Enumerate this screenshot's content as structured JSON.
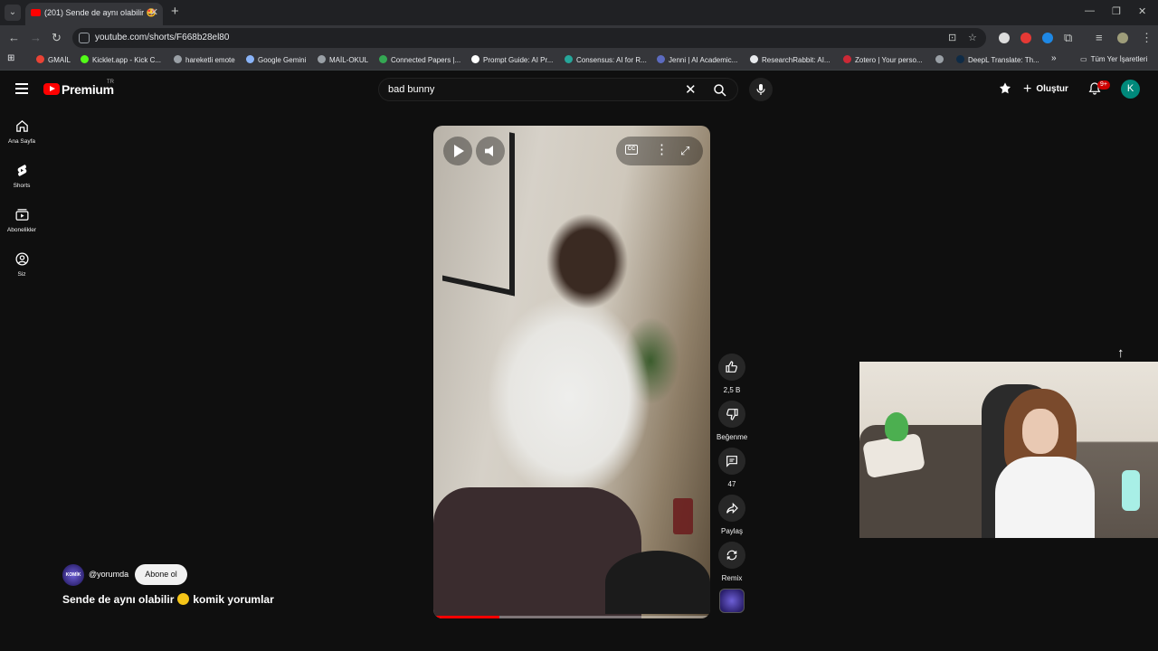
{
  "browser": {
    "tab_title": "(201) Sende de aynı olabilir 🤩",
    "url": "youtube.com/shorts/F668b28el80",
    "bookmarks": [
      "GMAİL",
      "Kicklet.app - Kick C...",
      "hareketli emote",
      "Google Gemini",
      "MAİL-OKUL",
      "Connected Papers |...",
      "Prompt Guide: AI Pr...",
      "Consensus: AI for R...",
      "Jenni | AI Academic...",
      "ResearchRabbit: AI...",
      "Zotero | Your perso...",
      "DeepL Translate: Th..."
    ],
    "all_bookmarks": "Tüm Yer İşaretleri",
    "overflow": "»"
  },
  "youtube": {
    "logo": "Premium",
    "logo_region": "TR",
    "search_value": "bad bunny",
    "create_label": "Oluştur",
    "notif_count": "9+",
    "avatar_letter": "K",
    "guide": [
      {
        "label": "Ana Sayfa"
      },
      {
        "label": "Shorts"
      },
      {
        "label": "Abonelikler"
      },
      {
        "label": "Siz"
      }
    ]
  },
  "short": {
    "channel_handle": "@yorumda",
    "channel_avatar_text": "KOMİK",
    "subscribe_label": "Abone ol",
    "title_part1": "Sende de aynı olabilir",
    "title_part2": "komik yorumlar",
    "progress_fraction": 0.24,
    "cc_label": "CC"
  },
  "actions": {
    "like_count": "2,5 B",
    "dislike_label": "Beğenme",
    "comment_count": "47",
    "share_label": "Paylaş",
    "remix_label": "Remix"
  },
  "colors": {
    "brand_red": "#ff0000",
    "bg": "#0f0f0f",
    "avatar": "#00897b"
  }
}
